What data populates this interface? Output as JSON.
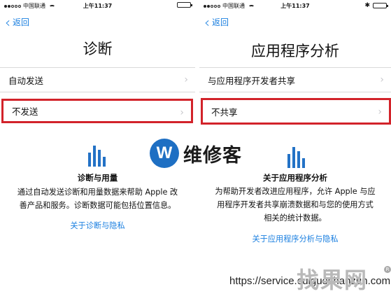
{
  "status_bar": {
    "carrier": "中国联通",
    "time": "上午11:37"
  },
  "left": {
    "back_label": "返回",
    "title": "诊断",
    "options": [
      {
        "label": "自动发送"
      },
      {
        "label": "不发送",
        "selected": true
      }
    ],
    "info_title": "诊断与用量",
    "info_lines": [
      "通过自动发送诊断和用量数据来帮助 Apple 改",
      "善产品和服务。诊断数据可能包括位置信息。"
    ],
    "link": "关于诊断与隐私"
  },
  "right": {
    "back_label": "返回",
    "title": "应用程序分析",
    "options": [
      {
        "label": "与应用程序开发者共享"
      },
      {
        "label": "不共享",
        "selected": true
      }
    ],
    "info_title": "关于应用程序分析",
    "info_lines": [
      "为帮助开发者改进应用程序，允许 Apple 与应",
      "用程序开发者共享崩溃数据和与您的使用方式",
      "相关的统计数据。"
    ],
    "link": "关于应用程序分析与隐私"
  },
  "watermark": {
    "logo_letter": "W",
    "center_text": "维修客",
    "url": "https://service.cuiguoshanzun.com",
    "brand": "找果网"
  },
  "colors": {
    "accent": "#1a7fe0",
    "highlight_box": "#d2232a",
    "chart_icon": "#2372c6"
  }
}
